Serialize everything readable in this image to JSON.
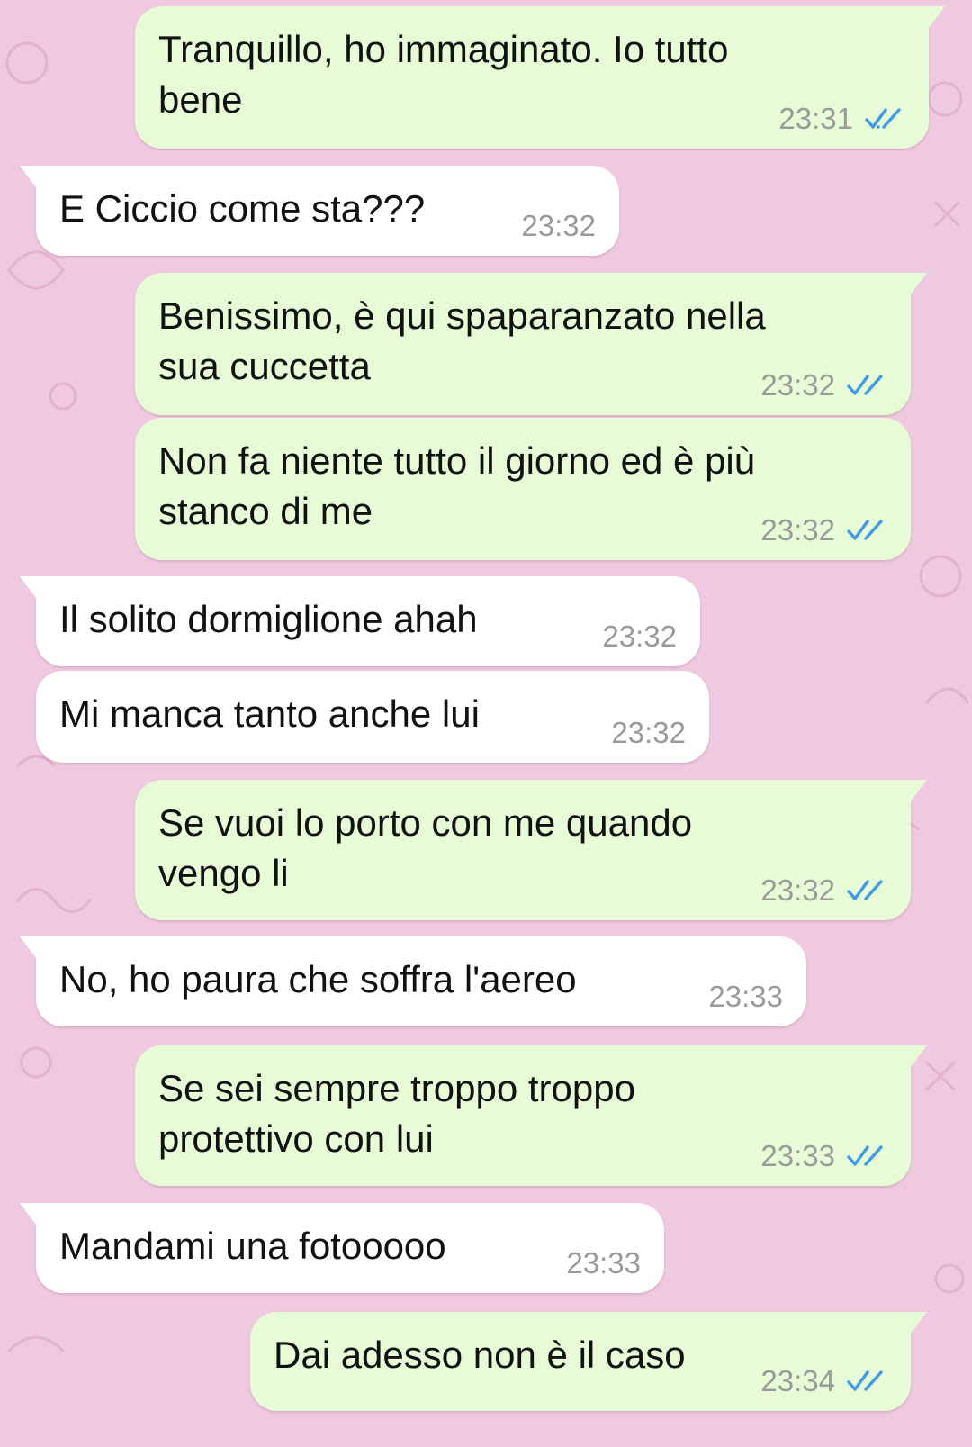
{
  "chat": {
    "messages": [
      {
        "dir": "out",
        "text": "Tranquillo, ho immaginato. Io tutto\nbene",
        "time": "23:31",
        "status": "read-double-check-icon"
      },
      {
        "dir": "in",
        "text": "E Ciccio come sta???",
        "time": "23:32"
      },
      {
        "dir": "out",
        "text": "Benissimo, è qui spaparanzato nella\nsua cuccetta",
        "time": "23:32",
        "status": "read-double-check-icon"
      },
      {
        "dir": "out",
        "text": "Non fa niente tutto il giorno ed è più\nstanco di me",
        "time": "23:32",
        "status": "read-double-check-icon"
      },
      {
        "dir": "in",
        "text": "Il solito dormiglione ahah",
        "time": "23:32"
      },
      {
        "dir": "in",
        "text": "Mi manca tanto anche lui",
        "time": "23:32"
      },
      {
        "dir": "out",
        "text": "Se vuoi lo porto con me quando\nvengo li",
        "time": "23:32",
        "status": "read-double-check-icon"
      },
      {
        "dir": "in",
        "text": "No, ho paura che soffra l'aereo",
        "time": "23:33"
      },
      {
        "dir": "out",
        "text": "Se sei sempre troppo troppo\nprotettivo con lui",
        "time": "23:33",
        "status": "read-double-check-icon"
      },
      {
        "dir": "in",
        "text": "Mandami una fotooooo",
        "time": "23:33"
      },
      {
        "dir": "out",
        "text": "Dai adesso non è il caso",
        "time": "23:34",
        "status": "read-double-check-icon"
      }
    ]
  },
  "colors": {
    "background": "#efc9e0",
    "outgoing_bubble": "#e6fbd6",
    "incoming_bubble": "#ffffff",
    "read_ticks": "#3d9be9",
    "timestamp": "#9a9a9a"
  }
}
